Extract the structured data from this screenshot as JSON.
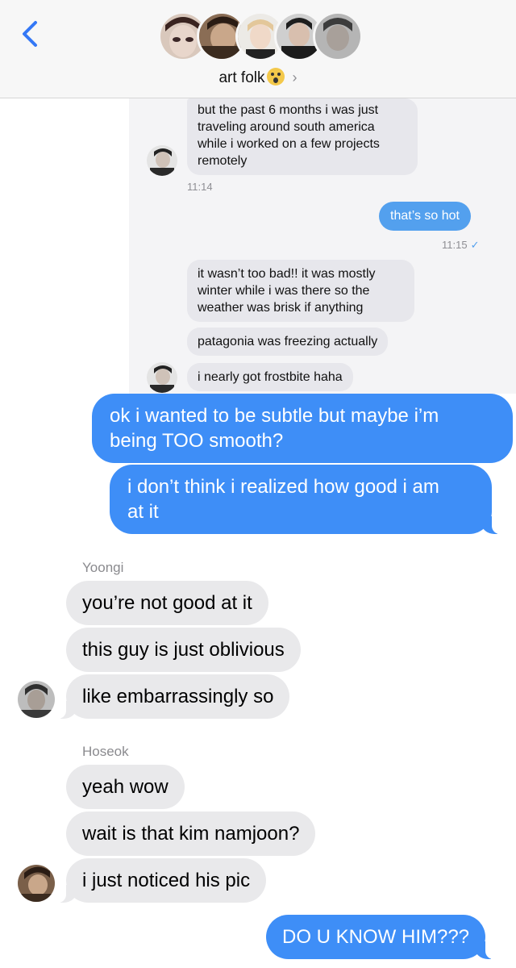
{
  "header": {
    "title": "art folk",
    "emoji_icon": "scream-emoji-icon",
    "chevron": "›",
    "back_icon": "chevron-left-icon"
  },
  "colors": {
    "accent": "#3e8ef7",
    "incoming": "#e9e9eb",
    "embedded_outgoing": "#53a0ee"
  },
  "embedded": {
    "msg1": [
      "but the past 6 months i was just",
      "traveling around south america",
      "while i worked on a few projects",
      "remotely"
    ],
    "time1": "11:14",
    "out1": "that’s so hot",
    "time2": "11:15",
    "msg2": [
      "it wasn’t too bad!! it was mostly",
      "winter while i was there so the",
      "weather was brisk if anything"
    ],
    "msg3": "patagonia was freezing actually",
    "msg4": "i nearly got frostbite haha"
  },
  "messages": {
    "out1_line1": "ok i wanted to be subtle but maybe i’m",
    "out1_line2": "being TOO smooth?",
    "out2_line1": "i don’t think i realized how good i am",
    "out2_line2": "at it",
    "sender1": "Yoongi",
    "y1": "you’re not good at it",
    "y2": "this guy is just oblivious",
    "y3": "like embarrassingly so",
    "sender2": "Hoseok",
    "h1": "yeah wow",
    "h2": "wait is that kim namjoon?",
    "h3": "i just noticed his pic",
    "out3": "DO U KNOW HIM???"
  }
}
